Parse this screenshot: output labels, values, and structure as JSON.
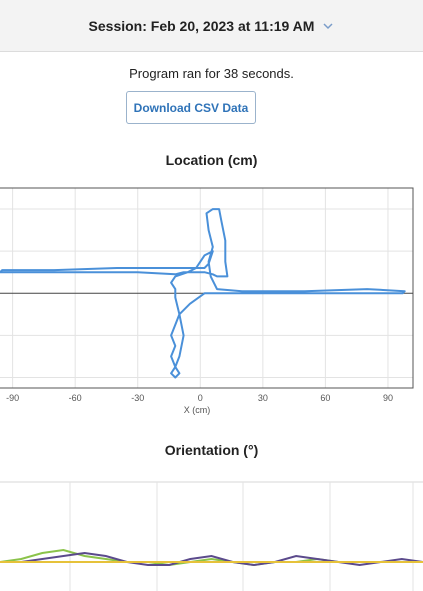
{
  "header": {
    "session_label": "Session: Feb 20, 2023 at 11:19 AM",
    "dropdown_icon": "chevron-down-icon"
  },
  "summary": {
    "runtime_text": "Program ran for 38 seconds."
  },
  "actions": {
    "download_csv_label": "Download CSV Data"
  },
  "colors": {
    "accent": "#2f73b8",
    "path": "#4a90d9",
    "grid": "#e3e3e3",
    "frame": "#555555"
  },
  "chart_data": [
    {
      "type": "line",
      "title": "Location (cm)",
      "xlabel": "X (cm)",
      "ylabel": "",
      "xlim": [
        -97,
        102
      ],
      "ylim": [
        -45,
        50
      ],
      "x_ticks": [
        -90,
        -60,
        -30,
        0,
        30,
        60,
        90
      ],
      "x_tick_labels": [
        "-90",
        "-60",
        "-30",
        "0",
        "30",
        "60",
        "90"
      ],
      "grid": true,
      "series": [
        {
          "x": [
            -95,
            -60,
            -30,
            -12,
            -8,
            2,
            6,
            8,
            10,
            13,
            12,
            12,
            10,
            9,
            6,
            3,
            4,
            6,
            4,
            5,
            8,
            20,
            50,
            80,
            98,
            97,
            80,
            50,
            20,
            2,
            -5,
            -10,
            -12,
            -14,
            -12,
            -14,
            -12,
            -10,
            -12,
            -14,
            -12,
            -10,
            -8,
            -10,
            -12,
            -12,
            -14,
            -12,
            -6,
            -2,
            0,
            2,
            6,
            4,
            2,
            -6,
            -20,
            -40,
            -70,
            -95,
            -96,
            -95
          ],
          "y": [
            10,
            10,
            10,
            9,
            10,
            10,
            9,
            8,
            8,
            8,
            15,
            25,
            35,
            40,
            40,
            38,
            30,
            22,
            15,
            8,
            2,
            1,
            1,
            2,
            1,
            0,
            0,
            0,
            0,
            0,
            -5,
            -10,
            -15,
            -20,
            -25,
            -30,
            -35,
            -38,
            -40,
            -38,
            -35,
            -30,
            -20,
            -10,
            -2,
            2,
            5,
            8,
            10,
            12,
            15,
            18,
            20,
            14,
            12,
            12,
            12,
            12,
            11,
            11,
            10,
            10
          ]
        }
      ]
    },
    {
      "type": "line",
      "title": "Orientation (°)",
      "xlabel": "",
      "ylabel": "",
      "grid": true,
      "series": [
        {
          "color": "#8bc34a",
          "x": [
            0,
            1,
            2,
            3,
            4,
            5,
            6,
            7,
            8,
            9,
            10,
            11,
            12,
            13,
            14,
            15,
            16,
            17,
            18,
            19,
            20
          ],
          "y": [
            0,
            1,
            3,
            4,
            2,
            1,
            0,
            0,
            -1,
            0,
            1,
            0,
            -1,
            0,
            0,
            1,
            0,
            0,
            0,
            0,
            0
          ]
        },
        {
          "color": "#5b4a8c",
          "x": [
            0,
            1,
            2,
            3,
            4,
            5,
            6,
            7,
            8,
            9,
            10,
            11,
            12,
            13,
            14,
            15,
            16,
            17,
            18,
            19,
            20
          ],
          "y": [
            0,
            0,
            1,
            2,
            3,
            2,
            0,
            -1,
            -1,
            1,
            2,
            0,
            -1,
            0,
            2,
            1,
            0,
            -1,
            0,
            1,
            0
          ]
        },
        {
          "color": "#e6c23a",
          "x": [
            0,
            1,
            2,
            3,
            4,
            5,
            6,
            7,
            8,
            9,
            10,
            11,
            12,
            13,
            14,
            15,
            16,
            17,
            18,
            19,
            20
          ],
          "y": [
            0,
            0,
            0,
            0,
            0,
            0,
            0,
            0,
            0,
            0,
            0,
            0,
            0,
            0,
            0,
            0,
            0,
            0,
            0,
            0,
            0
          ]
        }
      ]
    }
  ]
}
